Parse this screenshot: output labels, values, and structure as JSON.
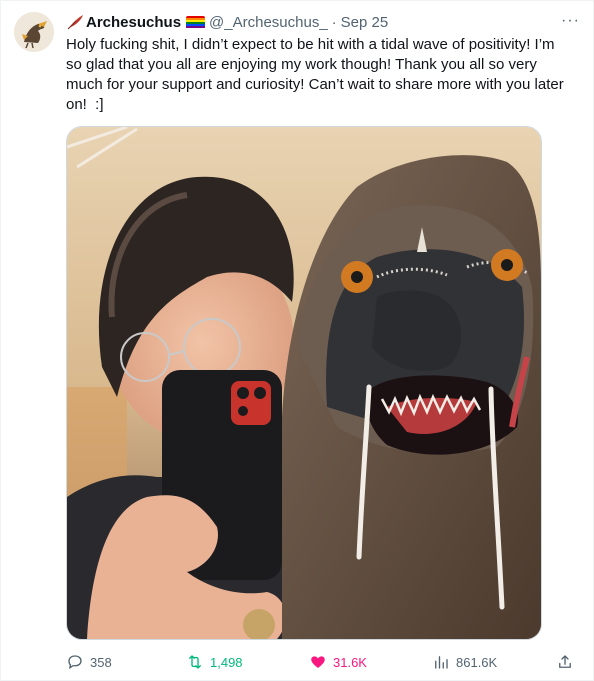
{
  "tweet": {
    "display_name": "Archesuchus",
    "handle": "@_Archesuchus_",
    "separator": "·",
    "date": "Sep 25",
    "more_label": "···",
    "text": "Holy fucking shit, I didn’t expect to be hit with a tidal wave of positivity! I’m so glad that you all are enjoying my work though! Thank you all so very much for your support and curiosity! Can’t wait to share more with you later on!  :]"
  },
  "actions": {
    "replies": "358",
    "retweets": "1,498",
    "likes": "31.6K",
    "views": "861.6K"
  },
  "icons": [
    "feather-icon",
    "rainbow-flag-icon",
    "more-icon",
    "reply-icon",
    "retweet-icon",
    "heart-icon",
    "views-icon",
    "share-icon"
  ],
  "colors": {
    "text": "#0f1419",
    "secondary": "#536471",
    "retweet_active": "#00ba7c",
    "like_active": "#f91880"
  }
}
